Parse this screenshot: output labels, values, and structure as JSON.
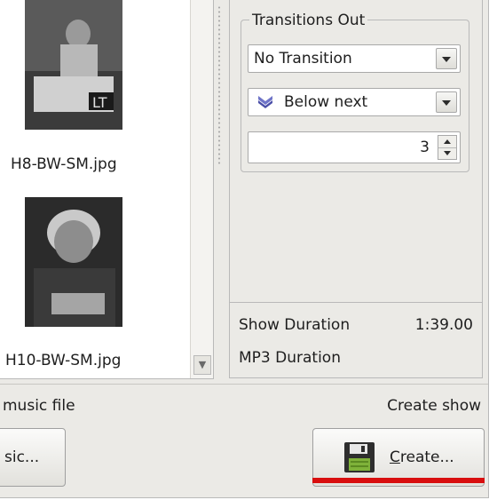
{
  "thumbnails": [
    {
      "caption": "H8-BW-SM.jpg"
    },
    {
      "caption": "H10-BW-SM.jpg"
    }
  ],
  "transitions_out": {
    "group_title": "Transitions Out",
    "transition_select": {
      "value": "No Transition"
    },
    "layer_select": {
      "value": "Below next",
      "icon": "chevron-double-down-icon"
    },
    "duration_spinner": {
      "value": "3"
    }
  },
  "durations": {
    "show_duration_label": "Show Duration",
    "show_duration_value": "1:39.00",
    "mp3_duration_label": "MP3 Duration"
  },
  "bottom": {
    "music_file_label": "music file",
    "create_show_label": "Create show",
    "music_button_label": "sic...",
    "create_button_label": "Create..."
  },
  "colors": {
    "highlight_bar": "#d80e0e",
    "panel_background": "#ebeae6"
  }
}
